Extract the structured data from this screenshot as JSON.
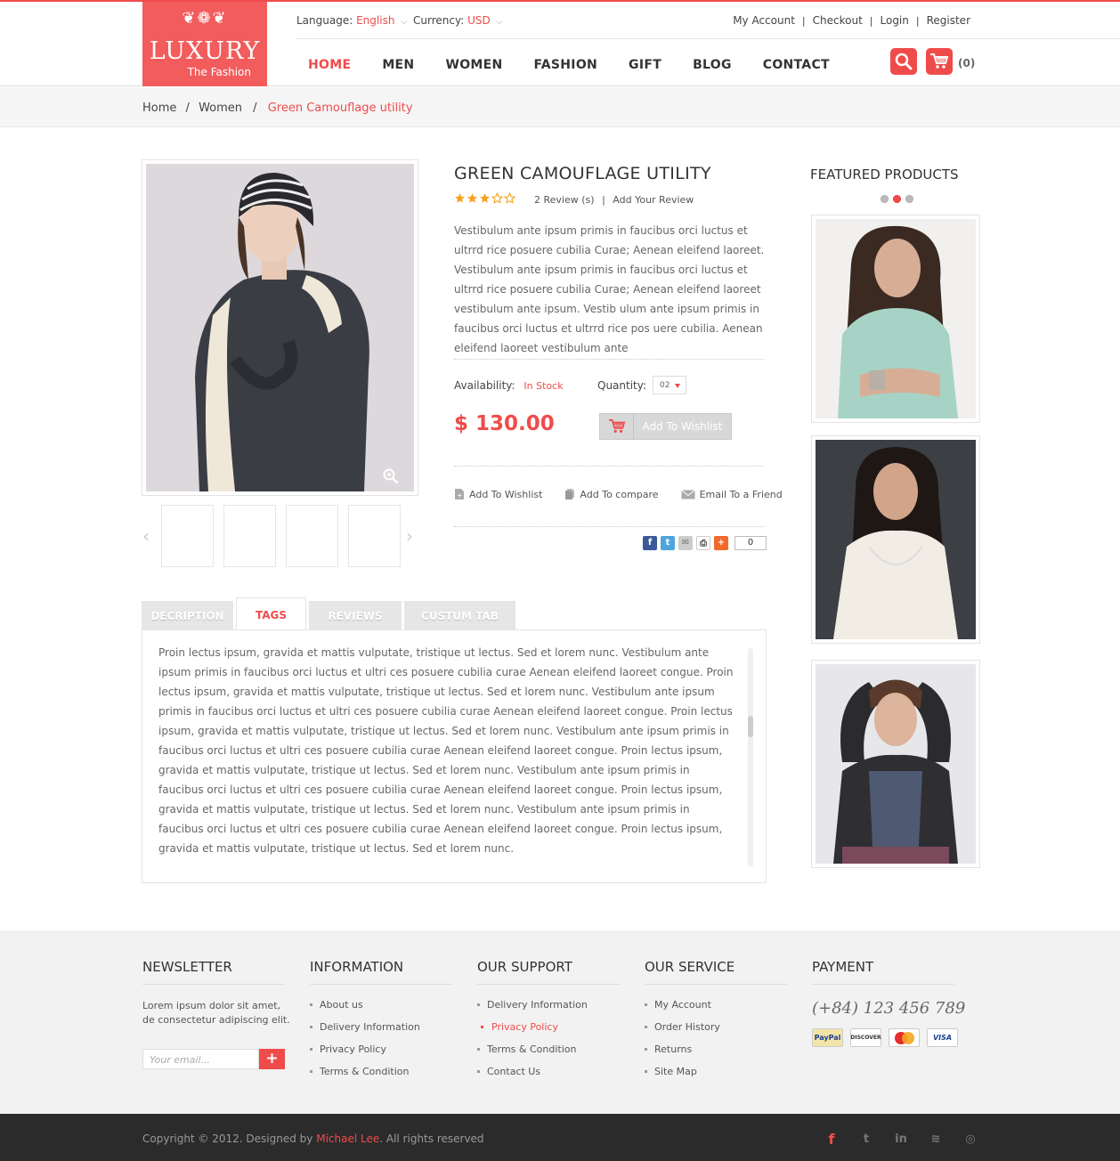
{
  "header": {
    "logo_ornament": "❦❁❦",
    "logo_title": "LUXURY",
    "logo_subtitle": "The Fashion",
    "language_label": "Language:",
    "language_value": "English",
    "currency_label": "Currency:",
    "currency_value": "USD",
    "account_links": [
      "My Account",
      "Checkout",
      "Login",
      "Register"
    ],
    "nav": [
      "HOME",
      "MEN",
      "WOMEN",
      "FASHION",
      "GIFT",
      "BLOG",
      "CONTACT"
    ],
    "active_nav": "HOME",
    "cart_count": "(0)"
  },
  "breadcrumb": {
    "items": [
      "Home",
      "Women"
    ],
    "current": "Green Camouflage utility",
    "separator": "/"
  },
  "product": {
    "title": "GREEN CAMOUFLAGE UTILITY",
    "rating": 3,
    "rating_max": 5,
    "reviews": "2 Review (s)",
    "add_review": "Add Your Review",
    "description": "Vestibulum ante ipsum primis in faucibus orci luctus et ultrrd rice posuere cubilia Curae; Aenean eleifend laoreet. Vestibulum ante ipsum primis in faucibus orci luctus et ultrrd rice posuere cubilia Curae; Aenean eleifend laoreet vestibulum ante ipsum. Vestib ulum ante ipsum primis in faucibus orci luctus et ultrrd rice pos uere cubilia. Aenean eleifend laoreet vestibulum ante",
    "availability_label": "Availability:",
    "availability_value": "In Stock",
    "quantity_label": "Quantity:",
    "quantity_value": "02",
    "price": "$ 130.00",
    "wishlist_button": "Add To Wishlist",
    "links": [
      "Add To Wishlist",
      "Add To compare",
      "Email To a Friend"
    ],
    "share_count": "0"
  },
  "tabs": {
    "items": [
      "DECRIPTION",
      "TAGS",
      "REVIEWS",
      "CUSTUM TAB"
    ],
    "active": "TAGS",
    "content": "Proin lectus ipsum, gravida et mattis vulputate, tristique ut lectus. Sed et lorem nunc. Vestibulum ante ipsum primis in faucibus orci luctus et ultri ces posuere cubilia curae Aenean eleifend laoreet congue. Proin lectus ipsum, gravida et mattis vulputate, tristique ut lectus. Sed et lorem nunc. Vestibulum ante ipsum primis in faucibus orci luctus et ultri ces posuere cubilia curae Aenean eleifend laoreet congue. Proin lectus ipsum, gravida et mattis vulputate, tristique ut lectus. Sed et lorem nunc. Vestibulum ante ipsum primis in faucibus orci luctus et ultri ces posuere cubilia curae Aenean eleifend laoreet congue. Proin lectus ipsum, gravida et mattis vulputate, tristique ut lectus. Sed et lorem nunc. Vestibulum ante ipsum primis in faucibus orci luctus et ultri ces posuere cubilia curae Aenean eleifend laoreet congue. Proin lectus ipsum, gravida et mattis vulputate, tristique ut lectus. Sed et lorem nunc. Vestibulum ante ipsum primis in faucibus orci luctus et ultri ces posuere cubilia curae Aenean eleifend laoreet congue. Proin lectus ipsum, gravida et mattis vulputate, tristique ut lectus. Sed et lorem nunc."
  },
  "featured": {
    "title": "FEATURED PRODUCTS",
    "active_dot": 2,
    "dot_count": 3
  },
  "footer": {
    "newsletter_title": "NEWSLETTER",
    "newsletter_text": "Lorem ipsum dolor sit amet, de consectetur adipiscing elit.",
    "email_placeholder": "Your email...",
    "information_title": "INFORMATION",
    "information_items": [
      "About us",
      "Delivery Information",
      "Privacy Policy",
      "Terms & Condition"
    ],
    "support_title": "OUR SUPPORT",
    "support_items": [
      "Delivery Information",
      "Privacy Policy",
      "Terms & Condition",
      "Contact Us"
    ],
    "service_title": "OUR SERVICE",
    "service_items": [
      "My Account",
      "Order History",
      "Returns",
      "Site Map"
    ],
    "payment_title": "PAYMENT",
    "phone": "(+84) 123 456 789",
    "cards": [
      "PayPal",
      "DISCOVER",
      "MC",
      "VISA"
    ]
  },
  "bottom": {
    "copyright": "Copyright © 2012. Designed by ",
    "designer": "Michael Lee",
    "rights": ". All rights reserved",
    "social": [
      "f",
      "t",
      "in",
      "rss",
      "dribbble"
    ]
  },
  "colors": {
    "accent": "#f04b4b",
    "footer_bg": "#f2f2f2",
    "bottom_bg": "#2b2b2b"
  }
}
